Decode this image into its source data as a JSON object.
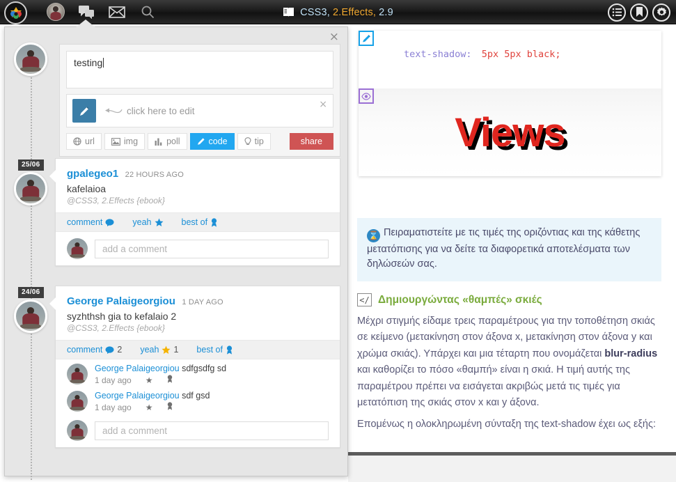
{
  "topbar": {
    "logo_name": "app-logo",
    "icons": [
      "user-avatar-icon",
      "chat-icon",
      "mail-icon",
      "search-icon"
    ],
    "title_book_icon": "book-icon",
    "title_part1": "CSS3,",
    "title_part2": "2.Effects,",
    "title_part3": "2.9",
    "right_icons": [
      "list-icon",
      "bookmark-icon",
      "gear-icon"
    ],
    "accent_blue": "#bfe0f5",
    "accent_orange": "#f0a830"
  },
  "composer": {
    "close_label": "×",
    "text_value": "testing",
    "attachment": {
      "icon": "pencil-icon",
      "hint": "click here to edit",
      "close_label": "×"
    },
    "tools": [
      {
        "label": "url",
        "icon": "globe-icon",
        "active": false
      },
      {
        "label": "img",
        "icon": "image-icon",
        "active": false
      },
      {
        "label": "poll",
        "icon": "bars-icon",
        "active": false
      },
      {
        "label": "code",
        "icon": "pencil-icon",
        "active": true
      },
      {
        "label": "tip",
        "icon": "bulb-icon",
        "active": false
      }
    ],
    "share_label": "share",
    "share_color": "#cf5454",
    "active_color": "#22a7f0"
  },
  "posts": [
    {
      "date_badge": "25/06",
      "author": "gpalegeo1",
      "time": "22 HOURS AGO",
      "text": "kafelaioa",
      "reference": "@CSS3, 2.Effects {ebook}",
      "actions": [
        {
          "label": "comment",
          "icon": "comment-icon",
          "count": ""
        },
        {
          "label": "yeah",
          "icon": "star-icon",
          "count": ""
        },
        {
          "label": "best of",
          "icon": "medal-icon",
          "count": ""
        }
      ],
      "replies": [],
      "comment_placeholder": "add a comment"
    },
    {
      "date_badge": "24/06",
      "author": "George Palaigeorgiou",
      "time": "1 DAY AGO",
      "text": "syzhthsh gia to kefalaio 2",
      "reference": "@CSS3, 2.Effects {ebook}",
      "actions": [
        {
          "label": "comment",
          "icon": "comment-icon",
          "count": "2"
        },
        {
          "label": "yeah",
          "icon": "star-icon",
          "count": "1"
        },
        {
          "label": "best of",
          "icon": "medal-icon",
          "count": ""
        }
      ],
      "replies": [
        {
          "author": "George Palaigeorgiou",
          "text": "sdfgsdfg sd",
          "time": "1 day ago",
          "icons": [
            "star-icon",
            "medal-icon"
          ]
        },
        {
          "author": "George Palaigeorgiou",
          "text": "sdf gsd",
          "time": "1 day ago",
          "icons": [
            "star-icon",
            "medal-icon"
          ]
        }
      ],
      "comment_placeholder": "add a comment"
    }
  ],
  "content": {
    "edit_icon": "pencil-icon",
    "preview_icon": "eye-icon",
    "code_property": "text-shadow:",
    "code_value": "5px 5px black;",
    "preview_text": "Views",
    "preview_color": "#e0261f",
    "preview_shadow": "5px 5px 0 #000",
    "note_icon": "hourglass-icon",
    "note_text": "Πειραματιστείτε με τις τιμές της οριζόντιας και της κάθετης μετατόπισης για να δείτε τα διαφορετικά αποτελέσματα των δηλώσεών σας.",
    "section_icon": "code-icon",
    "section_title": "Δημιουργώντας «θαμπές» σκιές",
    "section_title_color": "#7aab3d",
    "para1_a": "Μέχρι στιγμής είδαμε τρεις παραμέτρους για την τοποθέτηση σκιάς σε κείμενο (μετακίνηση στον άξονα x, μετακίνηση στον άξονα y και χρώμα σκιάς). Υπάρχει και μια τέταρτη που ονομάζεται ",
    "para1_bold": "blur-radius",
    "para1_b": " και καθορίζει το πόσο «θαμπή» είναι η σκιά. Η τιμή αυτής της παραμέτρου πρέπει να εισάγεται ακριβώς μετά τις τιμές για μετατόπιση της σκιάς στον x και y άξονα.",
    "para2": "Επομένως η ολοκληρωμένη σύνταξη της text-shadow έχει ως εξής:"
  }
}
